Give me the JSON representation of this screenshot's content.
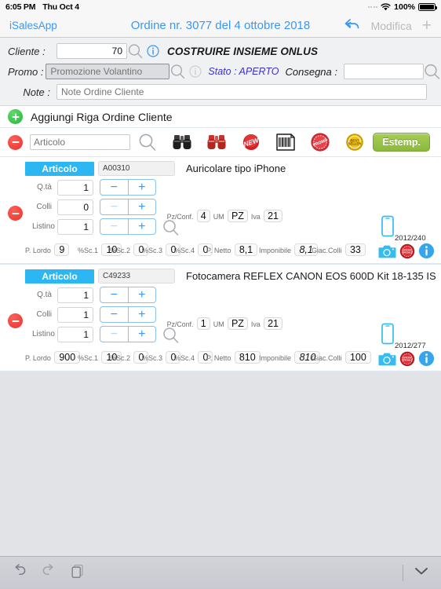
{
  "statusbar": {
    "time": "6:05 PM",
    "date": "Thu Oct 4",
    "battery_pct": "100%",
    "wifi_icon": "wifi-icon",
    "battery_icon": "battery-icon"
  },
  "navbar": {
    "app_name": "iSalesApp",
    "title": "Ordine nr. 3077 del 4 ottobre 2018",
    "undo_icon": "undo-arrow-icon",
    "edit_label": "Modifica",
    "add_icon": "plus-icon"
  },
  "form": {
    "cliente_label": "Cliente :",
    "cliente_value": "70",
    "cliente_search_icon": "search-icon",
    "cliente_info_icon": "info-icon",
    "company_name": "COSTRUIRE INSIEME ONLUS",
    "promo_label": "Promo :",
    "promo_placeholder": "Promozione Volantino",
    "promo_search_icon": "search-icon",
    "promo_info_icon": "info-icon",
    "stato_text": "Stato : APERTO",
    "consegna_label": "Consegna :",
    "consegna_value": "",
    "consegna_search_icon": "search-icon",
    "note_label": "Note :",
    "note_placeholder": "Note Ordine Cliente"
  },
  "add_row": {
    "add_icon": "add-circle-icon",
    "label": "Aggiungi Riga Ordine Cliente"
  },
  "toolbar": {
    "remove_icon": "remove-circle-icon",
    "articolo_placeholder": "Articolo",
    "icons": [
      "search-icon",
      "binoculars-black-icon",
      "binoculars-red-icon",
      "new-badge-icon",
      "barcode-icon",
      "promo-badge-icon",
      "best-seller-badge-icon"
    ],
    "estemp_label": "Estemp."
  },
  "field_captions": {
    "qta": "Q.tà",
    "colli": "Colli",
    "listino": "Listino",
    "pz_conf": "Pz/Conf.",
    "um": "UM",
    "iva": "Iva",
    "p_lordo": "P. Lordo",
    "sc1": "%Sc.1",
    "sc2": "%Sc.2",
    "sc3": "%Sc.3",
    "sc4": "%Sc.4",
    "p_netto": "P. Netto",
    "imponibile": "Imponibile",
    "giac_colli": "Giac.Colli",
    "minus": "−",
    "plus": "+"
  },
  "items": [
    {
      "articolo_label": "Articolo",
      "code": "A00310",
      "description": "Auricolare tipo iPhone",
      "qta": "1",
      "colli": "0",
      "listino": "1",
      "pz_conf": "4",
      "um": "PZ",
      "iva": "21",
      "p_lordo": "9",
      "sc1": "10",
      "sc2": "0",
      "sc3": "0",
      "sc4": "0",
      "p_netto": "8,1",
      "imponibile": "8,1",
      "giac_colli": "33",
      "badge_code": "2012/240",
      "phone_icon": "phone-icon",
      "camera_icon": "camera-icon",
      "offer_badge_icon": "offerta-speciale-badge-icon",
      "info_icon": "info-icon",
      "listino_search_icon": "search-icon",
      "remove_icon": "remove-circle-icon"
    },
    {
      "articolo_label": "Articolo",
      "code": "C49233",
      "description": "Fotocamera REFLEX CANON EOS 600D Kit 18-135 IS",
      "qta": "1",
      "colli": "1",
      "listino": "1",
      "pz_conf": "1",
      "um": "PZ",
      "iva": "21",
      "p_lordo": "900",
      "sc1": "10",
      "sc2": "0",
      "sc3": "0",
      "sc4": "0",
      "p_netto": "810",
      "imponibile": "810",
      "giac_colli": "100",
      "badge_code": "2012/277",
      "phone_icon": "phone-icon",
      "camera_icon": "camera-icon",
      "offer_badge_icon": "offerta-speciale-badge-icon",
      "info_icon": "info-icon",
      "listino_search_icon": "search-icon",
      "remove_icon": "remove-circle-icon"
    }
  ],
  "bottombar": {
    "undo_icon": "undo-icon",
    "redo_icon": "redo-icon",
    "copy_icon": "copy-icon",
    "dismiss_icon": "chevron-down-icon"
  },
  "colors": {
    "accent_blue": "#3a97f5",
    "articolo_blue": "#2cb6f2",
    "stato_purple": "#3b2fd6",
    "estemp_green": "#8cb93f",
    "remove_red": "#e8342c",
    "add_green": "#23b93a"
  }
}
